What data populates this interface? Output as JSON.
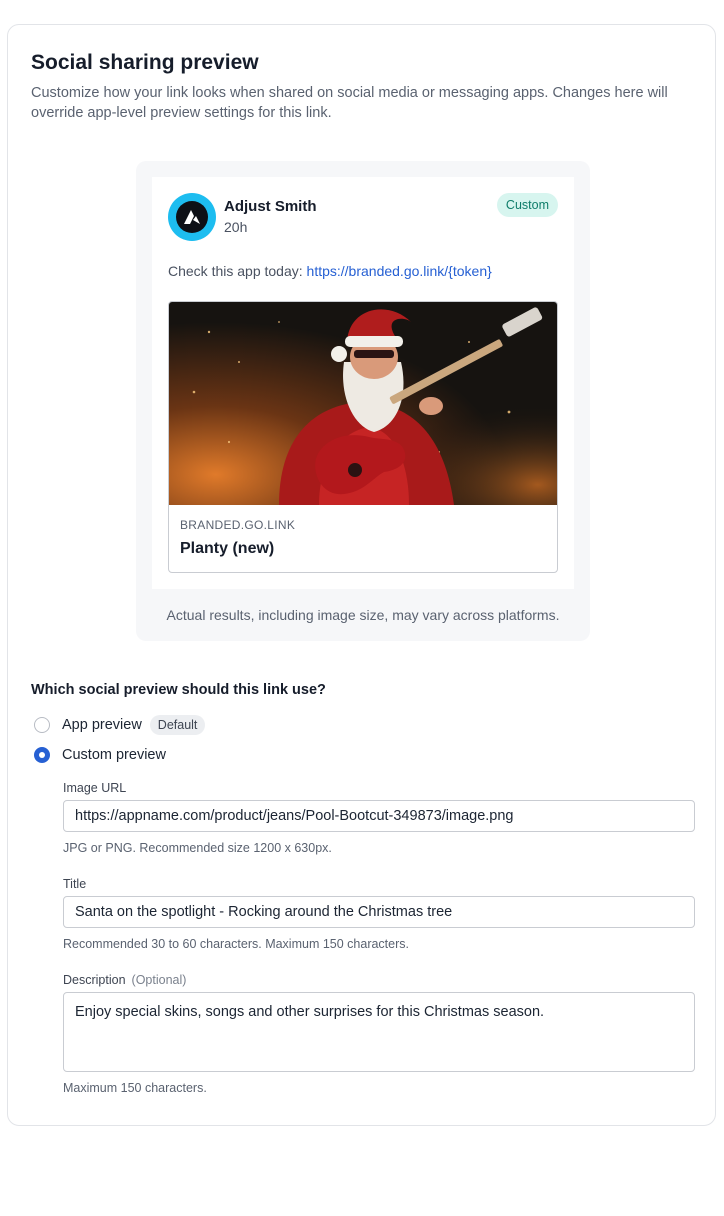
{
  "header": {
    "title": "Social sharing preview",
    "subtitle": "Customize how your link looks when shared on social media or messaging apps. Changes here will override app-level preview settings for this link."
  },
  "preview": {
    "author_name": "Adjust Smith",
    "post_time": "20h",
    "badge": "Custom",
    "post_text": "Check this app today: ",
    "post_link": "https://branded.go.link/{token}",
    "link_domain": "BRANDED.GO.LINK",
    "link_title": "Planty (new)",
    "disclaimer": "Actual results, including image size, may vary across platforms.",
    "avatar_icon": "adjust-logo-icon",
    "avatar_color": "#1dbdf0"
  },
  "options": {
    "question": "Which social preview should this link use?",
    "items": [
      {
        "label": "App preview",
        "badge": "Default",
        "selected": false
      },
      {
        "label": "Custom preview",
        "selected": true
      }
    ]
  },
  "form": {
    "image_url": {
      "label": "Image URL",
      "value": "https://appname.com/product/jeans/Pool-Bootcut-349873/image.png",
      "hint": "JPG or PNG. Recommended size 1200 x 630px."
    },
    "title": {
      "label": "Title",
      "value": "Santa on the spotlight - Rocking around the Christmas tree",
      "hint": "Recommended 30 to 60 characters. Maximum 150 characters."
    },
    "description": {
      "label": "Description",
      "optional": "(Optional)",
      "value": "Enjoy special skins, songs and other surprises for this Christmas season.",
      "hint": "Maximum 150 characters."
    }
  },
  "colors": {
    "accent": "#2660d3",
    "custom_badge_bg": "#d7f5ef",
    "custom_badge_text": "#0f7d6a"
  }
}
